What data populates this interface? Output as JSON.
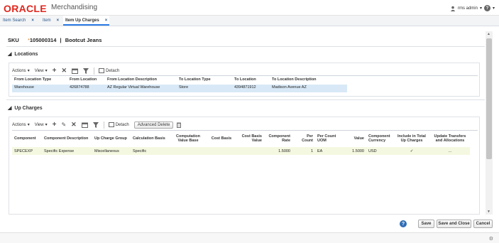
{
  "header": {
    "brand": "ORACLE",
    "app_name": "Merchandising",
    "user": "rms admin",
    "help": "?"
  },
  "tabs": [
    {
      "label": "Item Search"
    },
    {
      "label": "Item"
    },
    {
      "label": "Item Up Charges"
    }
  ],
  "sku": {
    "label": "SKU",
    "number": "105000314",
    "separator": "|",
    "name": "Bootcut Jeans"
  },
  "locations": {
    "title": "Locations",
    "actions_label": "Actions",
    "view_label": "View",
    "detach_label": "Detach",
    "columns": [
      "From Location Type",
      "From Location",
      "From Location Description",
      "To Location Type",
      "To Location",
      "To Location Description"
    ],
    "rows": [
      [
        "Warehouse",
        "426874788",
        "AZ Regular Virtual Warehouse",
        "Store",
        "4394871912",
        "Madison Avenue AZ"
      ]
    ]
  },
  "up_charges": {
    "title": "Up Charges",
    "actions_label": "Actions",
    "view_label": "View",
    "detach_label": "Detach",
    "advanced_delete_label": "Advanced Delete",
    "columns": [
      "Component",
      "Component Description",
      "Up Charge Group",
      "Calculation Basis",
      "Computation Value Base",
      "Cost Basis",
      "Cost Basis Value",
      "Component Rate",
      "Per Count",
      "Per Count UOM",
      "Value",
      "Component Currency",
      "Include in Total Up Charges",
      "Update Transfers and Allocations"
    ],
    "rows": [
      [
        "SPECEXP",
        "Specific Expense",
        "Miscellaneous",
        "Specific",
        "",
        "",
        "",
        "1.5000",
        "1",
        "EA",
        "1.5000",
        "USD",
        "✓",
        "..."
      ]
    ]
  },
  "footer": {
    "save_label": "Save",
    "save_close_label": "Save and Close",
    "cancel_label": "Cancel"
  }
}
